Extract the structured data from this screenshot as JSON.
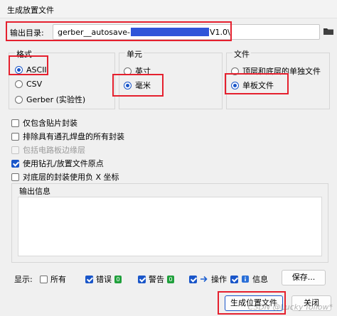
{
  "window": {
    "title": "生成放置文件"
  },
  "output_dir": {
    "label": "输出目录:",
    "value_prefix": "gerber__autosave-",
    "value_suffix": "V1.0\\"
  },
  "groups": {
    "format": {
      "title": "格式",
      "options": [
        "ASCII",
        "CSV",
        "Gerber (实验性)"
      ],
      "selected": "ASCII"
    },
    "units": {
      "title": "单元",
      "options": [
        "英寸",
        "毫米"
      ],
      "selected": "毫米"
    },
    "files": {
      "title": "文件",
      "options": [
        "顶层和底层的单独文件",
        "单板文件"
      ],
      "selected": "单板文件"
    }
  },
  "checkboxes": [
    {
      "label": "仅包含贴片封装",
      "checked": false,
      "disabled": false
    },
    {
      "label": "排除具有通孔焊盘的所有封装",
      "checked": false,
      "disabled": false
    },
    {
      "label": "包括电路板边缘层",
      "checked": false,
      "disabled": true
    },
    {
      "label": "使用钻孔/放置文件原点",
      "checked": true,
      "disabled": false
    },
    {
      "label": "对底层的封装使用负 X 坐标",
      "checked": false,
      "disabled": false
    }
  ],
  "messages": {
    "title": "输出信息"
  },
  "filters": {
    "show_label": "显示:",
    "all": {
      "label": "所有",
      "checked": false
    },
    "errors": {
      "label": "错误",
      "checked": true,
      "count": "0"
    },
    "warnings": {
      "label": "警告",
      "checked": true,
      "count": "0"
    },
    "actions": {
      "label": "操作",
      "checked": true
    },
    "info": {
      "label": "信息",
      "checked": true
    },
    "save_label": "保存..."
  },
  "buttons": {
    "generate": "生成位置文件",
    "close": "关闭"
  },
  "watermark": "CSDN @Lucky  follow*"
}
